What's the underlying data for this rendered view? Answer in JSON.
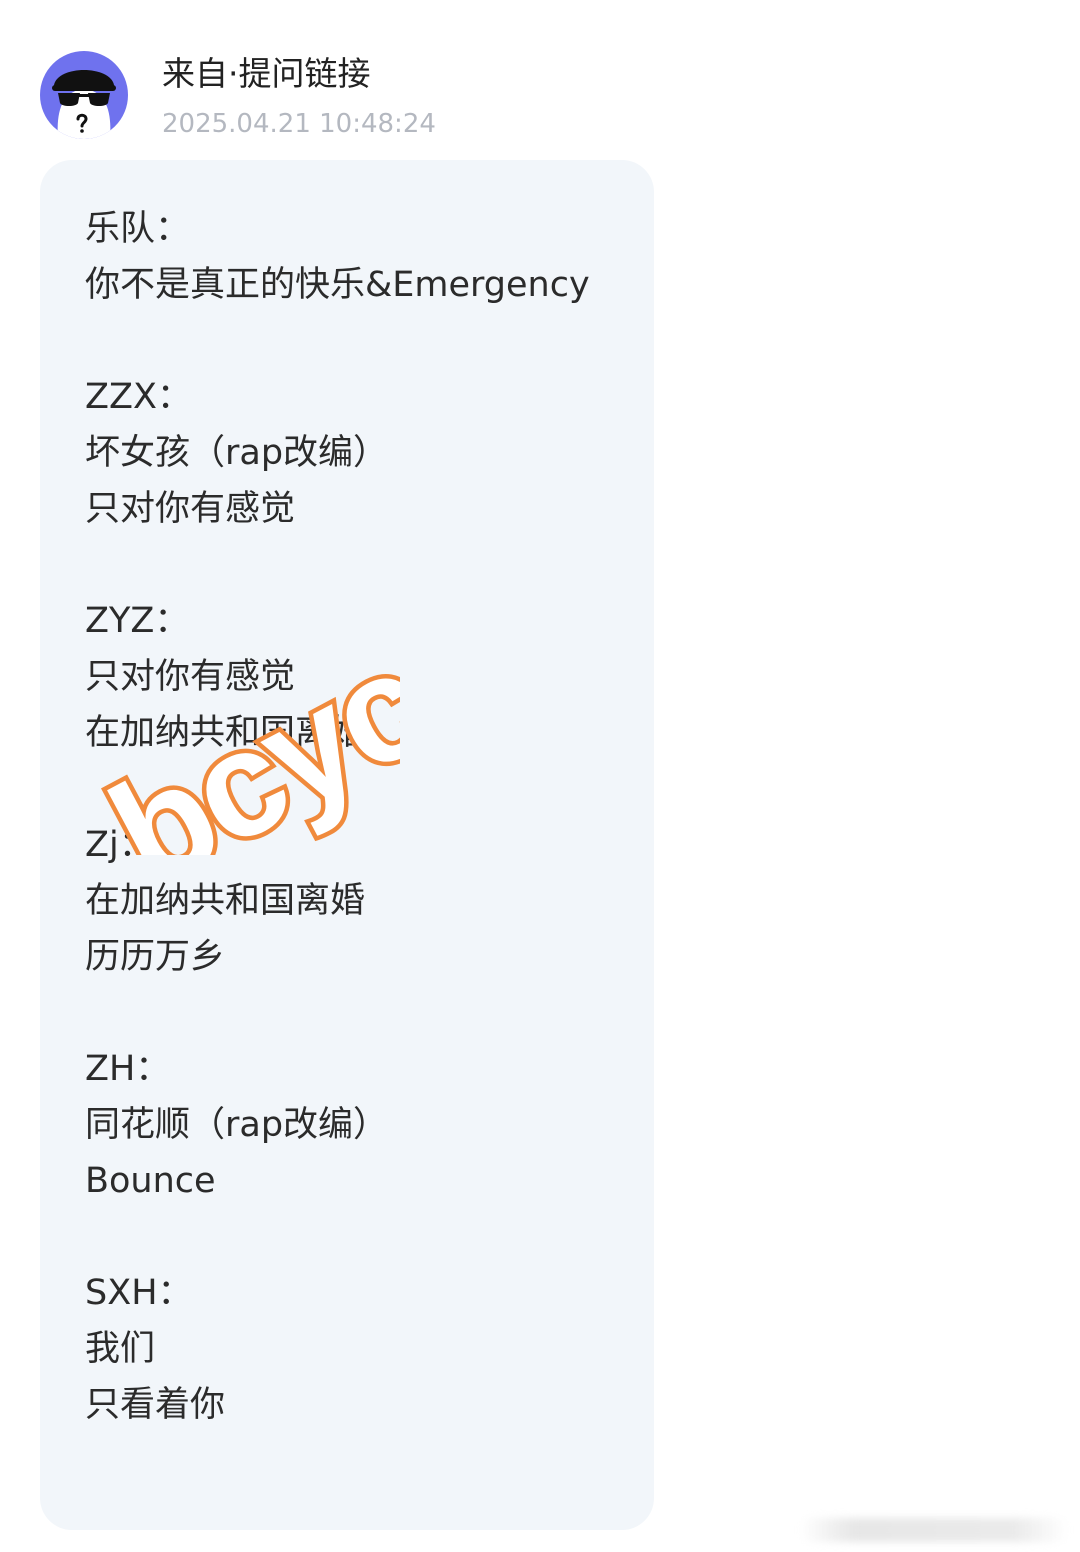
{
  "header": {
    "sender": "来自·提问链接",
    "timestamp": "2025.04.21 10:48:24"
  },
  "message": {
    "lines": [
      "乐队：",
      "你不是真正的快乐&Emergency",
      "",
      "ZZX：",
      "坏女孩（rap改编）",
      "只对你有感觉",
      "",
      "ZYZ：",
      "只对你有感觉",
      "在加纳共和国离婚",
      "",
      "Zj：",
      "在加纳共和国离婚",
      "历历万乡",
      "",
      "ZH：",
      "同花顺（rap改编）",
      "Bounce",
      "",
      "SXH：",
      "我们",
      "只看着你"
    ]
  },
  "watermark": {
    "text": "bcyc",
    "color": "#f08a3c"
  },
  "colors": {
    "avatar_bg": "#6f72ee",
    "bubble_bg": "#f2f6fa"
  },
  "icons": {
    "avatar": "anonymous-sunglasses-avatar-icon"
  }
}
